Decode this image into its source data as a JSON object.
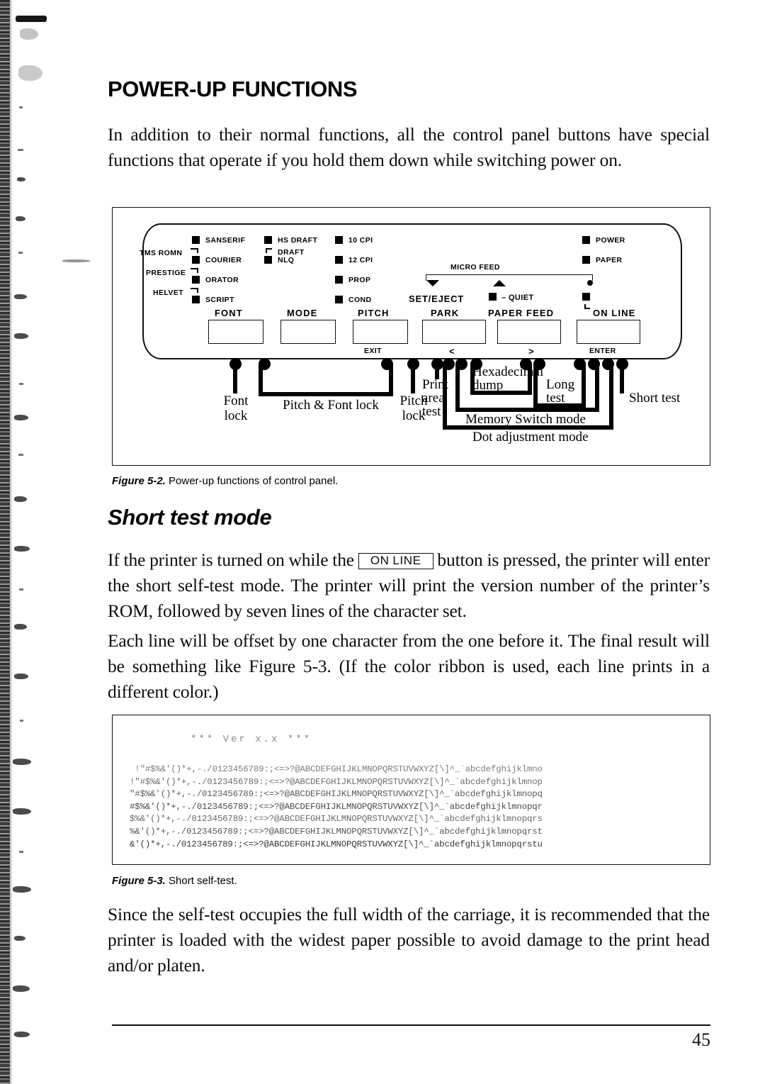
{
  "document": {
    "page_number": "45",
    "title": "POWER-UP FUNCTIONS",
    "intro_paragraph": "In addition to their normal functions, all the control panel buttons have special functions that operate if you hold them down while switching power on.",
    "subhead": "Short test mode",
    "paragraph_2_before_key": "If the printer is turned on while the",
    "inline_key_label": "ON LINE",
    "paragraph_2_after_key": "button is pressed, the printer will enter the short self-test mode. The printer will print the version number of the printer’s ROM, followed by seven lines of the character set.",
    "paragraph_3": "Each line will be offset by one character from the one before it. The final result will be something like Figure 5-3. (If the color ribbon is used, each line prints in a different color.)",
    "paragraph_4": "Since the self-test occupies the full width of the carriage, it is recommended that the printer is loaded with the widest paper possible to avoid damage to the print head and/or platen."
  },
  "figure_5_2": {
    "caption_label": "Figure 5-2.",
    "caption_text": "Power-up functions of control panel.",
    "panel": {
      "font_group": {
        "column_label": "FONT",
        "leds": [
          "SANSERIF",
          "COURIER",
          "ORATOR",
          "SCRIPT"
        ],
        "between_labels": [
          "TMS ROMN",
          "PRESTIGE",
          "HELVET"
        ]
      },
      "mode_group": {
        "column_label": "MODE",
        "leds": [
          "HS DRAFT",
          "NLQ"
        ],
        "between_labels": [
          "DRAFT"
        ]
      },
      "pitch_group": {
        "column_label": "PITCH",
        "leds": [
          "10 CPI",
          "12 CPI",
          "PROP",
          "COND"
        ],
        "exit_label": "EXIT"
      },
      "paper_group": {
        "micro_feed_label": "MICRO FEED",
        "set_eject_label": "SET/EJECT",
        "park_label": "PARK",
        "quiet_label": "– QUIET",
        "paper_feed_label": "PAPER FEED",
        "on_line_label": "ON LINE",
        "left_arrow_label": "<",
        "right_arrow_label": ">",
        "enter_label": "ENTER"
      },
      "status_leds": [
        "POWER",
        "PAPER"
      ]
    },
    "callouts": [
      "Font\nlock",
      "Pitch & Font lock",
      "Pitch\nlock",
      "Print\narea\ntest",
      "Hexadecimal\ndump",
      "Long\ntest",
      "Short test",
      "Memory Switch mode",
      "Dot adjustment mode"
    ]
  },
  "figure_5_3": {
    "caption_label": "Figure 5-3.",
    "caption_text": "Short self-test.",
    "version_line": "*** Ver x.x ***",
    "character_lines": [
      " !\"#$%&'()*+,-./0123456789:;<=>?@ABCDEFGHIJKLMNOPQRSTUVWXYZ[\\]^_`abcdefghijklmno",
      "!\"#$%&'()*+,-./0123456789:;<=>?@ABCDEFGHIJKLMNOPQRSTUVWXYZ[\\]^_`abcdefghijklmnop",
      "\"#$%&'()*+,-./0123456789:;<=>?@ABCDEFGHIJKLMNOPQRSTUVWXYZ[\\]^_`abcdefghijklmnopq",
      "#$%&'()*+,-./0123456789:;<=>?@ABCDEFGHIJKLMNOPQRSTUVWXYZ[\\]^_`abcdefghijklmnopqr",
      "$%&'()*+,-./0123456789:;<=>?@ABCDEFGHIJKLMNOPQRSTUVWXYZ[\\]^_`abcdefghijklmnopqrs",
      "%&'()*+,-./0123456789:;<=>?@ABCDEFGHIJKLMNOPQRSTUVWXYZ[\\]^_`abcdefghijklmnopqrst",
      "&'()*+,-./0123456789:;<=>?@ABCDEFGHIJKLMNOPQRSTUVWXYZ[\\]^_`abcdefghijklmnopqrstu"
    ]
  }
}
